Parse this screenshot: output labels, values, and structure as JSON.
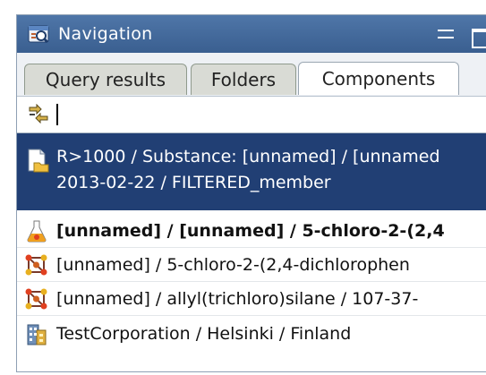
{
  "window": {
    "title": "Navigation"
  },
  "tabs": [
    {
      "label": "Query results",
      "active": false
    },
    {
      "label": "Folders",
      "active": false
    },
    {
      "label": "Components",
      "active": true
    }
  ],
  "filter": {
    "value": ""
  },
  "items": [
    {
      "icon": "document-folder-icon",
      "line1": "R>1000 / Substance: [unnamed] / [unnamed",
      "line2": "2013-02-22 / FILTERED_member",
      "selected": true
    },
    {
      "icon": "flask-icon",
      "text": "[unnamed] / [unnamed] / 5-chloro-2-(2,4",
      "bold": true
    },
    {
      "icon": "molecule-icon",
      "text": "[unnamed] / 5-chloro-2-(2,4-dichlorophen"
    },
    {
      "icon": "molecule-icon",
      "text": "[unnamed] / allyl(trichloro)silane / 107-37-"
    },
    {
      "icon": "building-icon",
      "text": "TestCorporation / Helsinki / Finland"
    }
  ],
  "colors": {
    "titlebar": "#3f659a",
    "selection": "#213f74",
    "tab_inactive": "#d9dbd5"
  }
}
